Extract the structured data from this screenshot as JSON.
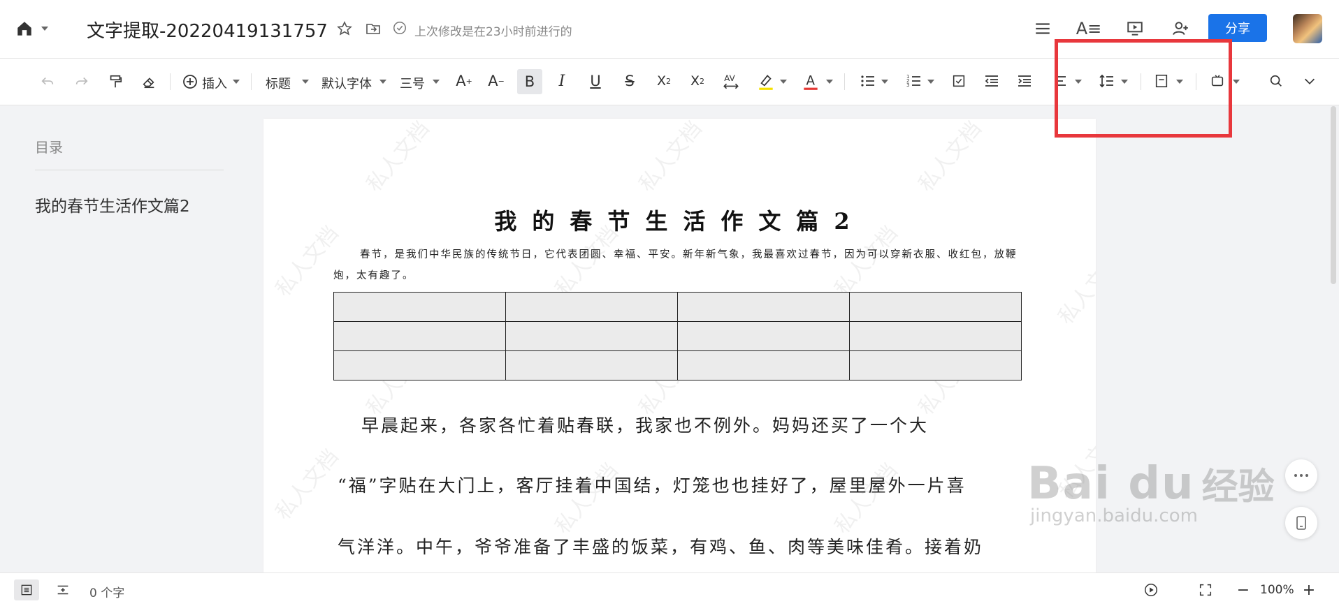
{
  "header": {
    "doc_title": "文字提取-20220419131757",
    "last_modified": "上次修改是在23小时前进行的",
    "share_label": "分享"
  },
  "toolbar": {
    "insert_label": "插入",
    "style_label": "标题",
    "font_label": "默认字体",
    "size_label": "三号"
  },
  "sidebar": {
    "title": "目录",
    "items": [
      "我的春节生活作文篇2"
    ]
  },
  "document": {
    "title": "我的春节生活作文篇2",
    "intro": "春节，是我们中华民族的传统节日，它代表团圆、幸福、平安。新年新气象，我最喜欢过春节，因为可以穿新衣服、收红包，放鞭炮，太有趣了。",
    "table": {
      "rows": 3,
      "cols": 4
    },
    "paragraph_lines": [
      "早晨起来，各家各忙着贴春联，我家也不例外。妈妈还买了一个大",
      "“福”字贴在大门上，客厅挂着中国结，灯笼也也挂好了，屋里屋外一片喜",
      "气洋洋。中午，爷爷准备了丰盛的饭菜，有鸡、鱼、肉等美味佳肴。接着奶"
    ],
    "watermark": "私人文档"
  },
  "status": {
    "word_count": "0 个字",
    "zoom": "100%"
  },
  "overlay": {
    "baidu_logo": "Bai du",
    "baidu_cn": "经验",
    "baidu_url": "jingyan.baidu.com"
  },
  "colors": {
    "accent": "#1a73e8",
    "highlight": "#e8373c",
    "highlighter_yellow": "#f5e100",
    "font_red": "#e53935"
  }
}
